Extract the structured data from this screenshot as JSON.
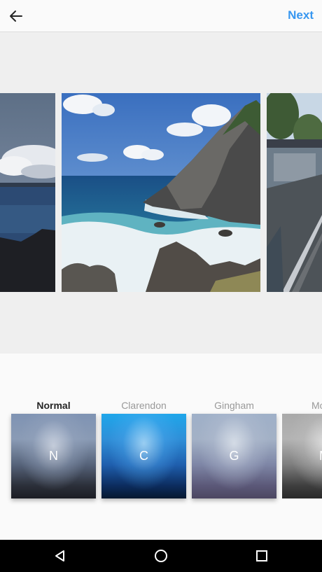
{
  "header": {
    "back_icon": "arrow-left-icon",
    "next_label": "Next",
    "accent_color": "#3897f0"
  },
  "preview": {
    "photos": [
      "coastal-cliff-left",
      "coastal-cliff-center",
      "train-station-right"
    ]
  },
  "filters": [
    {
      "name": "Normal",
      "letter": "N",
      "selected": true
    },
    {
      "name": "Clarendon",
      "letter": "C",
      "selected": false
    },
    {
      "name": "Gingham",
      "letter": "G",
      "selected": false
    },
    {
      "name": "Mo",
      "letter": "M",
      "selected": false
    }
  ],
  "system_nav": {
    "icons": [
      "back-triangle-icon",
      "home-circle-icon",
      "recents-square-icon"
    ]
  }
}
